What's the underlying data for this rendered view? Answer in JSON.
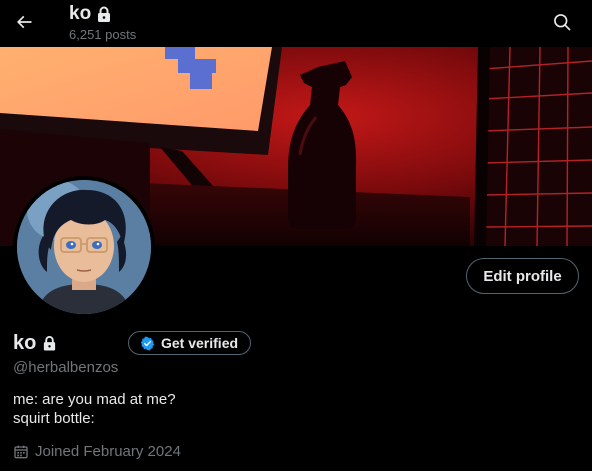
{
  "header": {
    "name": "ko",
    "posts_count": "6,251 posts"
  },
  "profile": {
    "display_name": "ko",
    "handle": "@herbalbenzos",
    "bio_lines": [
      "me: are you mad at me?",
      "squirt bottle:"
    ],
    "joined": "Joined February 2024"
  },
  "buttons": {
    "edit_profile": "Edit profile",
    "get_verified": "Get verified"
  },
  "icons": {
    "back": "arrow-left-icon",
    "search": "search-icon",
    "lock": "lock-icon",
    "verified": "verified-badge-icon",
    "calendar": "calendar-icon"
  },
  "colors": {
    "background": "#000000",
    "text_primary": "#e7e9ea",
    "text_secondary": "#71767b",
    "border": "#536471",
    "verified_blue": "#1d9bf0"
  }
}
